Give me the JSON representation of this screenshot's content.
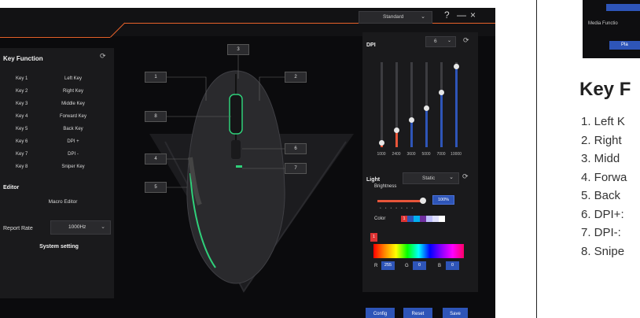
{
  "window": {
    "profile_select": "Standard",
    "help_label": "?",
    "minimize_label": "—",
    "close_label": "×"
  },
  "key_function": {
    "title": "Key Function",
    "rows": [
      {
        "key": "Key 1",
        "function": "Left Key"
      },
      {
        "key": "Key 2",
        "function": "Right Key"
      },
      {
        "key": "Key 3",
        "function": "Middle Key"
      },
      {
        "key": "Key 4",
        "function": "Forward Key"
      },
      {
        "key": "Key 5",
        "function": "Back Key"
      },
      {
        "key": "Key 6",
        "function": "DPI +"
      },
      {
        "key": "Key 7",
        "function": "DPI -"
      },
      {
        "key": "Key 8",
        "function": "Sniper Key"
      }
    ]
  },
  "editor": {
    "title": "Editor",
    "macro_editor": "Macro Editor"
  },
  "report_rate": {
    "label": "Report Rate",
    "value": "1000Hz"
  },
  "system_setting": "System setting",
  "callouts": [
    "1",
    "2",
    "3",
    "4",
    "5",
    "6",
    "7",
    "8"
  ],
  "dpi": {
    "title": "DPI",
    "selected_level": "6",
    "levels": [
      {
        "label": "1000",
        "fraction": 0.06,
        "color": "#e8553a"
      },
      {
        "label": "2400",
        "fraction": 0.2,
        "color": "#e8553a"
      },
      {
        "label": "3600",
        "fraction": 0.32,
        "color": "#2e55b8"
      },
      {
        "label": "5000",
        "fraction": 0.46,
        "color": "#2e55b8"
      },
      {
        "label": "7000",
        "fraction": 0.65,
        "color": "#2e55b8"
      },
      {
        "label": "10000",
        "fraction": 0.95,
        "color": "#2e55b8"
      }
    ]
  },
  "light": {
    "title": "Light",
    "mode": "Static",
    "brightness_label": "Brightness",
    "brightness_value": "100%",
    "color_label": "Color",
    "swatch_marker": "1",
    "swatches": [
      "#d33",
      "#2e55b8",
      "#00b0f0",
      "#7030a0",
      "#c0c0ff",
      "#e0e0ff",
      "#ffffff"
    ],
    "spectrum_marker": "1",
    "r_label": "R",
    "r_value": "255",
    "g_label": "G",
    "g_value": "0",
    "b_label": "B",
    "b_value": "0"
  },
  "buttons": {
    "config": "Config",
    "reset": "Reset",
    "save": "Save"
  },
  "colors": {
    "accent": "#e8622a",
    "primary_button": "#2e55b8",
    "mouse_led": "#2fd07a"
  },
  "document": {
    "media_function": "Media Functio",
    "play_label": "Pla",
    "title": "Key F",
    "lines": [
      "1. Left K",
      "2. Right",
      "3. Midd",
      "4. Forwa",
      "5. Back",
      "6. DPI+:",
      "7. DPI-:",
      "8. Snipe"
    ]
  }
}
